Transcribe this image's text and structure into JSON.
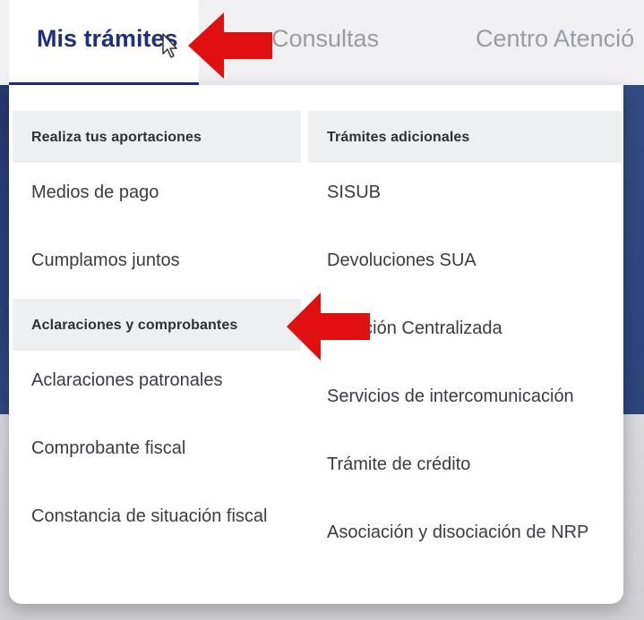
{
  "nav": {
    "tabs": [
      {
        "label": "Mis trámites"
      },
      {
        "label": "Consultas"
      },
      {
        "label": "Centro Atenció"
      }
    ]
  },
  "menu": {
    "left": {
      "section1": {
        "title": "Realiza tus aportaciones",
        "items": [
          "Medios de pago",
          "Cumplamos juntos"
        ]
      },
      "section2": {
        "title": "Aclaraciones y comprobantes",
        "items": [
          "Aclaraciones patronales",
          "Comprobante fiscal",
          "Constancia de situación fiscal"
        ]
      }
    },
    "right": {
      "title": "Trámites adicionales",
      "items": [
        "SISUB",
        "Devoluciones SUA",
        "Atención Centralizada",
        "Servicios de intercomunicación",
        "Trámite de crédito",
        "Asociación y disociación de NRP"
      ]
    }
  },
  "colors": {
    "accent": "#1f2f7a",
    "arrow": "#e01010"
  }
}
